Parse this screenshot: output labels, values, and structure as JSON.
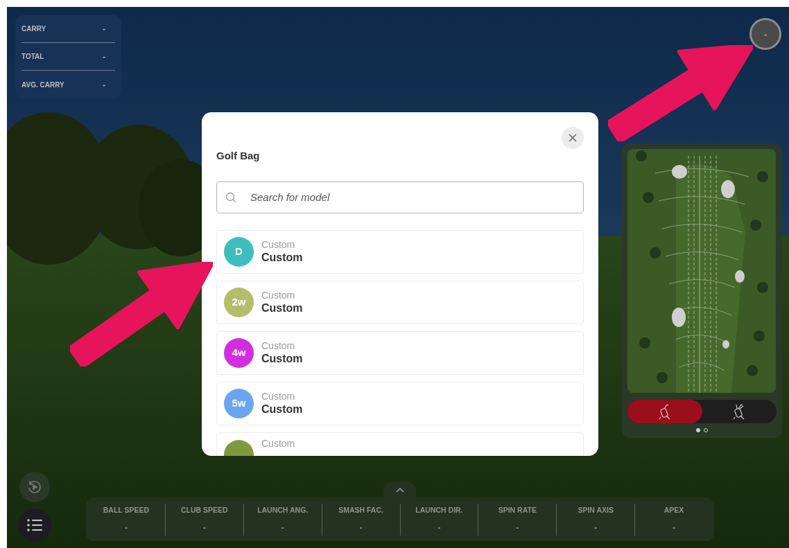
{
  "stats": [
    {
      "label": "CARRY",
      "value": "-"
    },
    {
      "label": "TOTAL",
      "value": "-"
    },
    {
      "label": "AVG. CARRY",
      "value": "-"
    }
  ],
  "profile_button": {
    "label": "-"
  },
  "modal": {
    "title": "Golf Bag",
    "search": {
      "placeholder": "Search for model"
    },
    "clubs": [
      {
        "badge": "D",
        "color": "#3fbdbd",
        "subtitle": "Custom",
        "name": "Custom"
      },
      {
        "badge": "2w",
        "color": "#b3be6a",
        "subtitle": "Custom",
        "name": "Custom"
      },
      {
        "badge": "4w",
        "color": "#d42de0",
        "subtitle": "Custom",
        "name": "Custom"
      },
      {
        "badge": "5w",
        "color": "#6aa6ee",
        "subtitle": "Custom",
        "name": "Custom"
      },
      {
        "color": "#7f9a3c",
        "subtitle": "Custom"
      }
    ]
  },
  "minimap": {
    "tabs": [
      {
        "selected": true
      },
      {
        "selected": false
      }
    ],
    "pages": [
      {
        "selected": true
      },
      {
        "selected": false
      }
    ]
  },
  "metrics": [
    {
      "label": "BALL SPEED",
      "value": "-"
    },
    {
      "label": "CLUB SPEED",
      "value": "-"
    },
    {
      "label": "LAUNCH ANG.",
      "value": "-"
    },
    {
      "label": "SMASH FAC.",
      "value": "-"
    },
    {
      "label": "LAUNCH DIR.",
      "value": "-"
    },
    {
      "label": "SPIN RATE",
      "value": "-"
    },
    {
      "label": "SPIN AXIS",
      "value": "-"
    },
    {
      "label": "APEX",
      "value": "-"
    }
  ]
}
